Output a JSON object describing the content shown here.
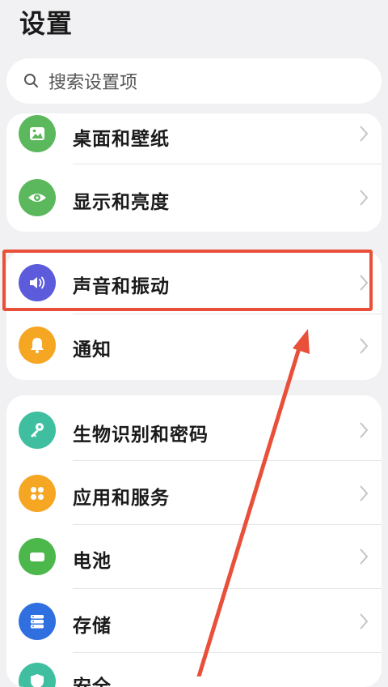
{
  "header": {
    "title": "设置"
  },
  "search": {
    "placeholder": "搜索设置项",
    "icon": "search-icon"
  },
  "groups": [
    {
      "items": [
        {
          "label": "桌面和壁纸",
          "icon": "wallpaper-icon",
          "color": "#5cb85c"
        },
        {
          "label": "显示和亮度",
          "icon": "eye-icon",
          "color": "#5cb85c"
        }
      ]
    },
    {
      "items": [
        {
          "label": "声音和振动",
          "icon": "speaker-icon",
          "color": "#5b5bdc",
          "highlighted": true
        },
        {
          "label": "通知",
          "icon": "bell-icon",
          "color": "#f5a623"
        }
      ]
    },
    {
      "items": [
        {
          "label": "生物识别和密码",
          "icon": "key-icon",
          "color": "#3fbfa0"
        },
        {
          "label": "应用和服务",
          "icon": "apps-grid-icon",
          "color": "#f5a623"
        },
        {
          "label": "电池",
          "icon": "battery-icon",
          "color": "#4cb84c"
        },
        {
          "label": "存储",
          "icon": "storage-icon",
          "color": "#2f6fe0"
        },
        {
          "label": "安全",
          "icon": "shield-icon",
          "color": "#3fbfa0"
        }
      ]
    }
  ],
  "annotation": {
    "highlight_color": "#e8503a",
    "arrow_color": "#e8503a"
  }
}
